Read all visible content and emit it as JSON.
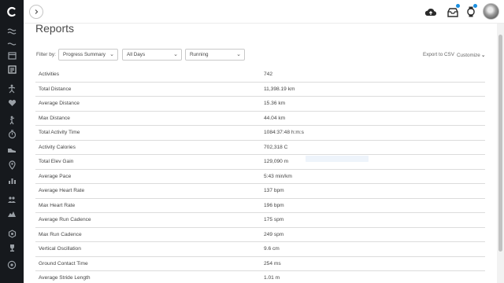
{
  "app": {
    "page_title": "Reports"
  },
  "sidebar": {
    "logo": "garmin-connect-logo",
    "items": [
      {
        "icon": "stream-icon"
      },
      {
        "icon": "waves-icon"
      },
      {
        "icon": "calendar-icon"
      },
      {
        "icon": "report-icon"
      },
      {
        "icon": "activity-person-icon"
      },
      {
        "icon": "heart-icon"
      },
      {
        "icon": "golf-icon"
      },
      {
        "icon": "timer-icon"
      },
      {
        "icon": "shoe-icon"
      },
      {
        "icon": "location-pin-icon"
      },
      {
        "icon": "bar-chart-icon"
      },
      {
        "icon": "people-icon"
      },
      {
        "icon": "mountains-icon"
      },
      {
        "icon": "badge-icon"
      },
      {
        "icon": "trophy-icon"
      },
      {
        "icon": "plus-circle-icon"
      }
    ]
  },
  "topbar": {
    "collapse_icon": "chevron-right-icon",
    "icons": [
      "cloud-upload-icon",
      "inbox-icon",
      "watch-icon"
    ],
    "notification_color": "#1a8fe0"
  },
  "filters": {
    "label": "Filter by:",
    "report_type": "Progress Summary",
    "date_range": "All Days",
    "activity_type": "Running"
  },
  "actions": {
    "export": "Export to CSV",
    "customize": "Customize"
  },
  "rows": [
    {
      "label": "Activities",
      "value": "742"
    },
    {
      "label": "Total Distance",
      "value": "11,398.19 km"
    },
    {
      "label": "Average Distance",
      "value": "15.36 km"
    },
    {
      "label": "Max Distance",
      "value": "44.04 km"
    },
    {
      "label": "Total Activity Time",
      "value": "1084:37:48 h:m:s"
    },
    {
      "label": "Activity Calories",
      "value": "702,318 C"
    },
    {
      "label": "Total Elev Gain",
      "value": "129,090 m"
    },
    {
      "label": "Average Pace",
      "value": "5:43 min/km"
    },
    {
      "label": "Average Heart Rate",
      "value": "137 bpm"
    },
    {
      "label": "Max Heart Rate",
      "value": "196 bpm"
    },
    {
      "label": "Average Run Cadence",
      "value": "175 spm"
    },
    {
      "label": "Max Run Cadence",
      "value": "249 spm"
    },
    {
      "label": "Vertical Oscillation",
      "value": "9.6 cm"
    },
    {
      "label": "Ground Contact Time",
      "value": "254 ms"
    },
    {
      "label": "Average Stride Length",
      "value": "1.01 m"
    }
  ]
}
